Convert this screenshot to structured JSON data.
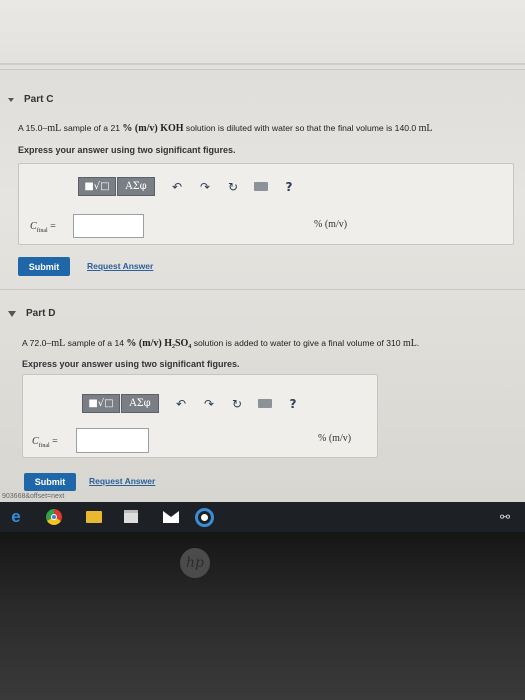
{
  "partC": {
    "title": "Part C",
    "question_pre": "A 15.0",
    "question_vol": "–mL",
    "question_mid": " sample of a 21 ",
    "question_conc": "% (m/v) KOH",
    "question_post": " solution is diluted with water so that the final volume is 140.0 ",
    "question_unit": "mL",
    "instruction": "Express your answer using two significant figures.",
    "toolbar_templates": "■√□",
    "toolbar_symbols": "ΑΣφ",
    "help": "?",
    "lhs": "C",
    "lhs_sub": "final",
    "equals": "=",
    "input_value": "",
    "unit": "% (m/v)",
    "submit": "Submit",
    "request": "Request Answer"
  },
  "partD": {
    "title": "Part D",
    "question_pre": "A 72.0",
    "question_vol": "–mL",
    "question_mid": " sample of a 14 ",
    "question_conc": "% (m/v) H₂SO₄",
    "question_post": " solution is added to water to give a final volume of 310 ",
    "question_unit": "mL",
    "question_end": ".",
    "instruction": "Express your answer using two significant figures.",
    "toolbar_templates": "■√□",
    "toolbar_symbols": "ΑΣφ",
    "help": "?",
    "lhs": "C",
    "lhs_sub": "final",
    "equals": "=",
    "input_value": "",
    "unit": "% (m/v)",
    "submit": "Submit",
    "request": "Request Answer"
  },
  "status_url": "903668&offset=next",
  "hp_logo": "hp",
  "taskbar": {
    "icons": [
      "edge-icon",
      "chrome-icon",
      "file-explorer-icon",
      "store-icon",
      "mail-icon",
      "circle-app-icon",
      "people-icon"
    ]
  }
}
